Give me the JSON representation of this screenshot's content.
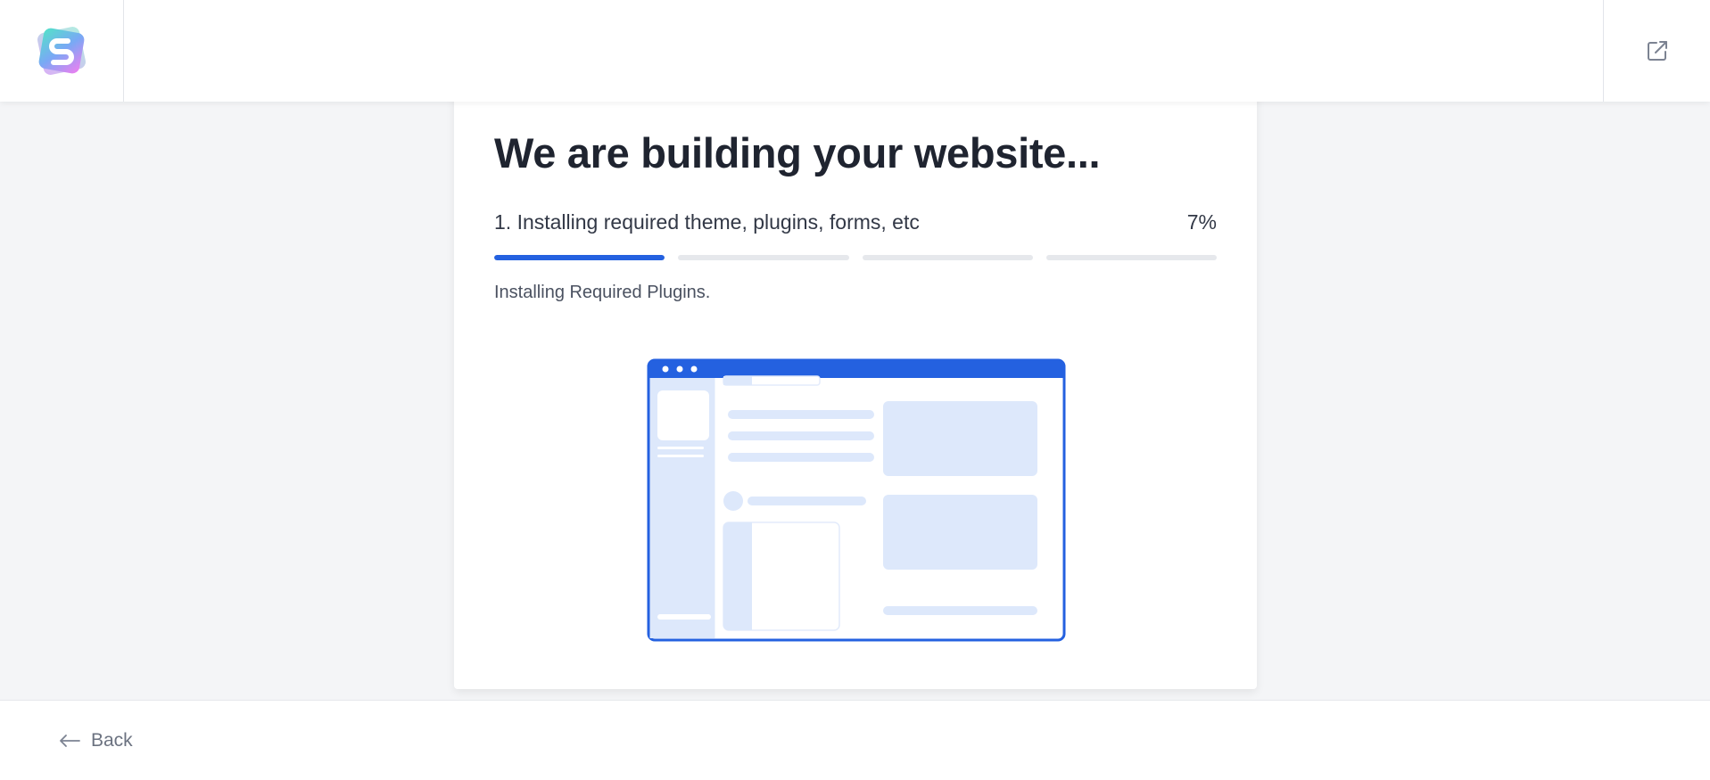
{
  "header": {
    "logo_icon": "starter-templates-logo-icon",
    "exit_icon": "external-link-icon"
  },
  "card": {
    "title": "We are building your website...",
    "step_label": "1. Installing required theme, plugins, forms, etc",
    "step_percent": "7%",
    "progress": {
      "segments": 4,
      "active_segment": 1,
      "active_segment_fill": 1.0
    },
    "status_text": "Installing Required Plugins.",
    "illustration": "website-building-illustration"
  },
  "footer": {
    "back_label": "Back",
    "back_icon": "arrow-left-icon"
  },
  "colors": {
    "accent": "#2461e0",
    "page_background": "#f4f5f7",
    "card_background": "#ffffff",
    "inactive_progress": "#e6e8ec",
    "illustration_light": "#dde8fb"
  }
}
